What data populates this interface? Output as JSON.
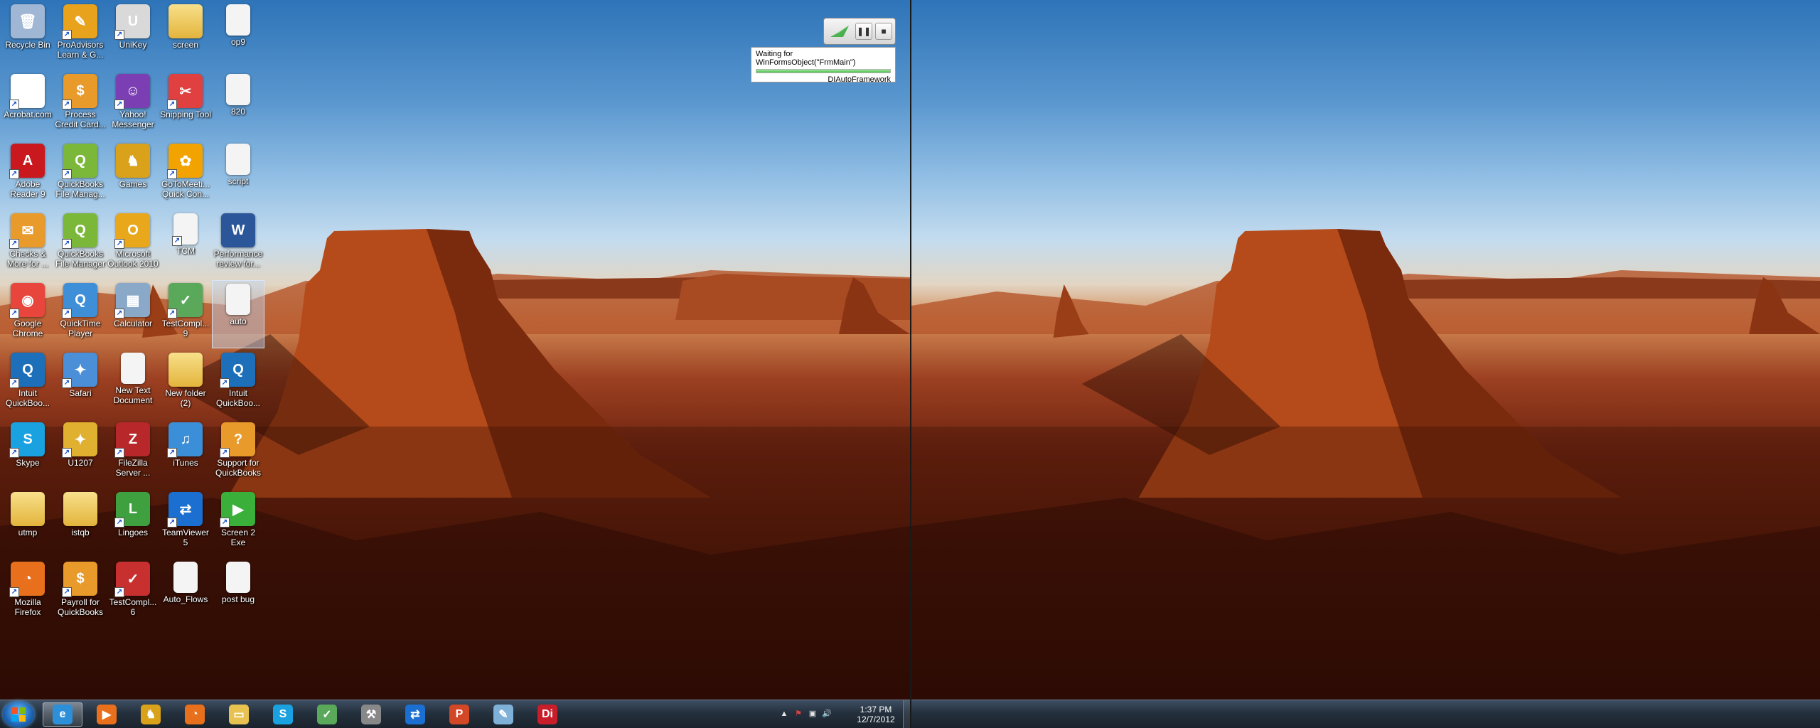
{
  "desktop": {
    "icons": [
      {
        "label": "Recycle Bin",
        "icon": "recycle-bin-icon",
        "color": "#9fb7d4",
        "glyph": "🗑",
        "shortcut": false
      },
      {
        "label": "ProAdvisors Learn & G...",
        "icon": "proadvisor-icon",
        "color": "#e8a21c",
        "glyph": "✎",
        "shortcut": true
      },
      {
        "label": "UniKey",
        "icon": "unikey-icon",
        "color": "#d9d9d9",
        "glyph": "U",
        "shortcut": true
      },
      {
        "label": "screen",
        "icon": "folder-icon",
        "color": "#e8c250",
        "glyph": "",
        "shortcut": false,
        "folder": true
      },
      {
        "label": "op9",
        "icon": "file-icon",
        "color": "#f0f0f0",
        "glyph": "",
        "shortcut": false
      },
      {
        "label": "Acrobat.com",
        "icon": "acrobat-icon",
        "color": "#ffffff",
        "glyph": "A",
        "shortcut": true
      },
      {
        "label": "Process Credit Card...",
        "icon": "credit-card-icon",
        "color": "#e89a2a",
        "glyph": "$",
        "shortcut": true
      },
      {
        "label": "Yahoo! Messenger",
        "icon": "yahoo-messenger-icon",
        "color": "#7b3fb3",
        "glyph": "☺",
        "shortcut": true
      },
      {
        "label": "Snipping Tool",
        "icon": "snipping-tool-icon",
        "color": "#e04040",
        "glyph": "✂",
        "shortcut": true
      },
      {
        "label": "820",
        "icon": "file-icon",
        "color": "#f0f0f0",
        "glyph": "",
        "shortcut": false
      },
      {
        "label": "Adobe Reader 9",
        "icon": "adobe-reader-icon",
        "color": "#c9181e",
        "glyph": "A",
        "shortcut": true
      },
      {
        "label": "QuickBooks File Manag...",
        "icon": "quickbooks-file-manager-icon",
        "color": "#7bb83a",
        "glyph": "Q",
        "shortcut": true
      },
      {
        "label": "Games",
        "icon": "games-icon",
        "color": "#d9a21a",
        "glyph": "♞",
        "shortcut": false
      },
      {
        "label": "GoToMeeti... Quick Con...",
        "icon": "gotomeeting-icon",
        "color": "#f2a300",
        "glyph": "✿",
        "shortcut": true
      },
      {
        "label": "script",
        "icon": "file-icon",
        "color": "#f0f0f0",
        "glyph": "",
        "shortcut": false
      },
      {
        "label": "Checks & More for ...",
        "icon": "checks-icon",
        "color": "#e89a2a",
        "glyph": "✉",
        "shortcut": true
      },
      {
        "label": "QuickBooks File Manager",
        "icon": "quickbooks-file-manager-icon",
        "color": "#7bb83a",
        "glyph": "Q",
        "shortcut": true
      },
      {
        "label": "Microsoft Outlook 2010",
        "icon": "outlook-icon",
        "color": "#e9a71c",
        "glyph": "O",
        "shortcut": true
      },
      {
        "label": "TCM",
        "icon": "file-icon",
        "color": "#f0f0f0",
        "glyph": "",
        "shortcut": true
      },
      {
        "label": "Performance review for...",
        "icon": "word-doc-icon",
        "color": "#2b579a",
        "glyph": "W",
        "shortcut": false
      },
      {
        "label": "Google Chrome",
        "icon": "chrome-icon",
        "color": "#e8453c",
        "glyph": "◉",
        "shortcut": true
      },
      {
        "label": "QuickTime Player",
        "icon": "quicktime-icon",
        "color": "#3f8fd8",
        "glyph": "Q",
        "shortcut": true
      },
      {
        "label": "Calculator",
        "icon": "calculator-icon",
        "color": "#8aa9c9",
        "glyph": "▦",
        "shortcut": true
      },
      {
        "label": "TestCompl... 9",
        "icon": "testcomplete-icon",
        "color": "#5aa85a",
        "glyph": "✓",
        "shortcut": true
      },
      {
        "label": "auto",
        "icon": "file-icon",
        "color": "#f0f0f0",
        "glyph": "",
        "shortcut": false,
        "selected": true
      },
      {
        "label": "Intuit QuickBoo...",
        "icon": "intuit-quickbooks-icon",
        "color": "#1c6fb8",
        "glyph": "Q",
        "shortcut": true
      },
      {
        "label": "Safari",
        "icon": "safari-icon",
        "color": "#4a8fd8",
        "glyph": "✦",
        "shortcut": true
      },
      {
        "label": "New Text Document",
        "icon": "text-document-icon",
        "color": "#f0f0f0",
        "glyph": "",
        "shortcut": false
      },
      {
        "label": "New folder (2)",
        "icon": "folder-icon",
        "color": "#e8c250",
        "glyph": "",
        "shortcut": false,
        "folder": true
      },
      {
        "label": "Intuit QuickBoo...",
        "icon": "intuit-quickbooks-icon",
        "color": "#1c6fb8",
        "glyph": "Q",
        "shortcut": true
      },
      {
        "label": "Skype",
        "icon": "skype-icon",
        "color": "#1aa1e0",
        "glyph": "S",
        "shortcut": true
      },
      {
        "label": "U1207",
        "icon": "u1207-icon",
        "color": "#e0b030",
        "glyph": "✦",
        "shortcut": true
      },
      {
        "label": "FileZilla Server ...",
        "icon": "filezilla-icon",
        "color": "#b8272a",
        "glyph": "Z",
        "shortcut": true
      },
      {
        "label": "iTunes",
        "icon": "itunes-icon",
        "color": "#3a8fd8",
        "glyph": "♫",
        "shortcut": true
      },
      {
        "label": "Support for QuickBooks",
        "icon": "support-quickbooks-icon",
        "color": "#e89a2a",
        "glyph": "?",
        "shortcut": true
      },
      {
        "label": "utmp",
        "icon": "folder-icon",
        "color": "#e8c250",
        "glyph": "",
        "shortcut": false,
        "folder": true
      },
      {
        "label": "istqb",
        "icon": "folder-icon",
        "color": "#e8c250",
        "glyph": "",
        "shortcut": false,
        "folder": true
      },
      {
        "label": "Lingoes",
        "icon": "lingoes-icon",
        "color": "#3fa03f",
        "glyph": "L",
        "shortcut": true
      },
      {
        "label": "TeamViewer 5",
        "icon": "teamviewer-icon",
        "color": "#1a6fd0",
        "glyph": "⇄",
        "shortcut": true
      },
      {
        "label": "Screen 2 Exe",
        "icon": "screen2exe-icon",
        "color": "#3ab03a",
        "glyph": "▶",
        "shortcut": true
      },
      {
        "label": "Mozilla Firefox",
        "icon": "firefox-icon",
        "color": "#e8701c",
        "glyph": "◔",
        "shortcut": true
      },
      {
        "label": "Payroll for QuickBooks",
        "icon": "payroll-icon",
        "color": "#e89a2a",
        "glyph": "$",
        "shortcut": true
      },
      {
        "label": "TestCompl... 6",
        "icon": "testcomplete-icon",
        "color": "#c83030",
        "glyph": "✓",
        "shortcut": true
      },
      {
        "label": "Auto_Flows",
        "icon": "auto-flows-icon",
        "color": "#f0f0f0",
        "glyph": "",
        "shortcut": false
      },
      {
        "label": "post bug",
        "icon": "post-bug-icon",
        "color": "#f0f0f0",
        "glyph": "",
        "shortcut": false
      }
    ]
  },
  "automation": {
    "status_text": "Waiting for WinFormsObject(\"FrmMain\")",
    "framework_name": "DIAutoFramework",
    "progress": 1.0,
    "pause_label": "❚❚",
    "stop_label": "■"
  },
  "taskbar": {
    "apps": [
      {
        "name": "internet-explorer",
        "color": "#2d8fd8",
        "glyph": "e",
        "active": true
      },
      {
        "name": "media-player",
        "color": "#e8701c",
        "glyph": "▶",
        "active": false
      },
      {
        "name": "games",
        "color": "#d9a21a",
        "glyph": "♞",
        "active": false
      },
      {
        "name": "firefox",
        "color": "#e8701c",
        "glyph": "◔",
        "active": false
      },
      {
        "name": "explorer",
        "color": "#e8c250",
        "glyph": "▭",
        "active": false
      },
      {
        "name": "skype",
        "color": "#1aa1e0",
        "glyph": "S",
        "active": false
      },
      {
        "name": "testcomplete",
        "color": "#5aa85a",
        "glyph": "✓",
        "active": false
      },
      {
        "name": "tools",
        "color": "#888888",
        "glyph": "⚒",
        "active": false
      },
      {
        "name": "teamviewer",
        "color": "#1a6fd0",
        "glyph": "⇄",
        "active": false
      },
      {
        "name": "powerpoint",
        "color": "#d24726",
        "glyph": "P",
        "active": false
      },
      {
        "name": "notepad",
        "color": "#7fb0d8",
        "glyph": "✎",
        "active": false
      },
      {
        "name": "di-app",
        "color": "#c81e2a",
        "glyph": "Di",
        "active": false
      }
    ],
    "clock_time": "1:37 PM",
    "clock_date": "12/7/2012",
    "tray_chevron": "▲"
  }
}
